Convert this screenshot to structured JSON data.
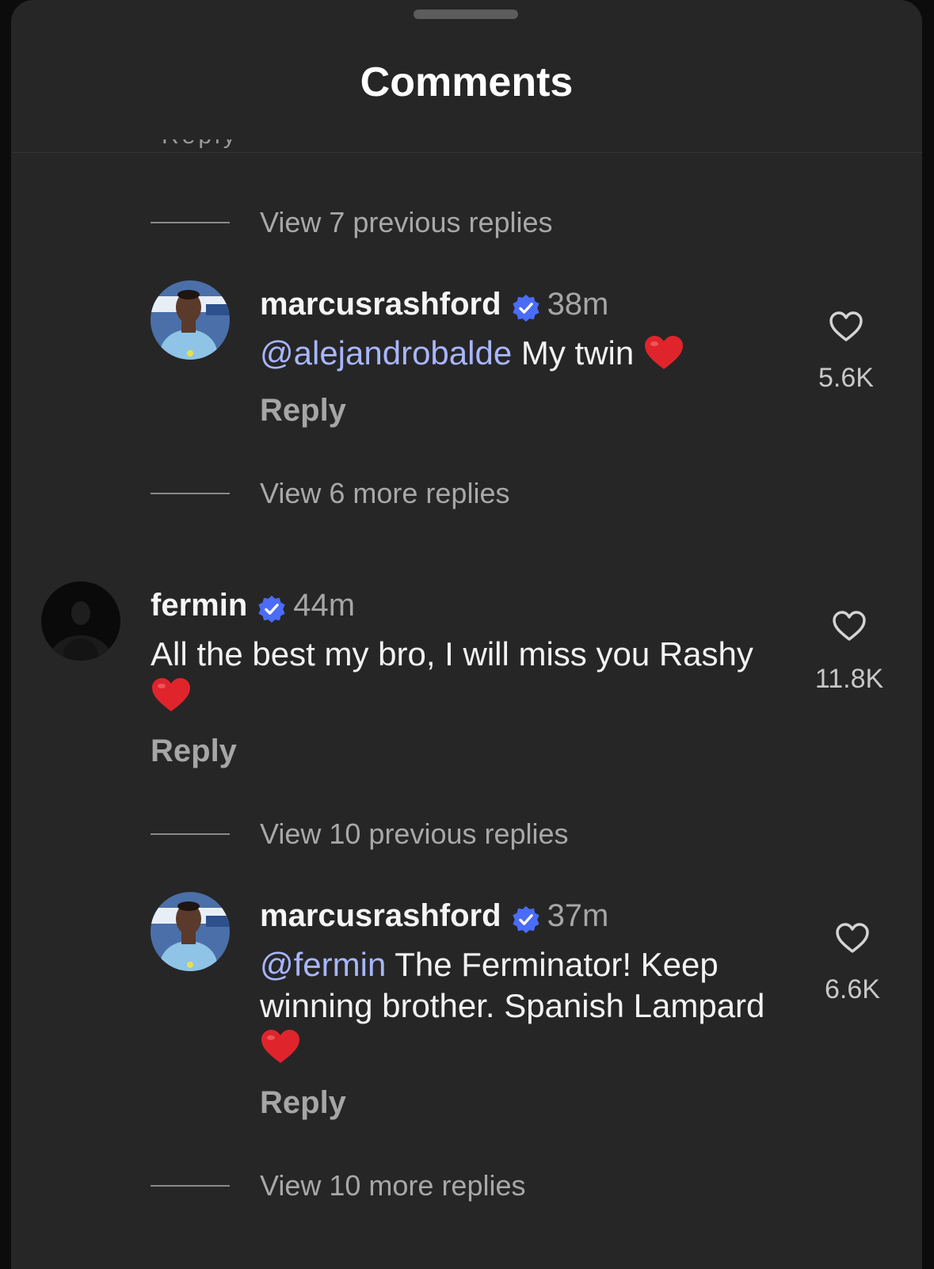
{
  "header": {
    "title": "Comments",
    "cutoff_text": "Reply"
  },
  "threads": {
    "view_previous_1": "View 7 previous replies",
    "view_more_1": "View 6 more replies",
    "view_previous_2": "View 10 previous replies",
    "view_more_2": "View 10 more replies"
  },
  "comments": [
    {
      "username": "marcusrashford",
      "time": "38m",
      "mention": "@alejandrobalde",
      "text": " My twin ",
      "reply_label": "Reply",
      "likes": "5.6K",
      "verified": true
    },
    {
      "username": "fermin",
      "time": "44m",
      "mention": "",
      "text": "All the best my bro, I will miss you Rashy",
      "reply_label": "Reply",
      "likes": "11.8K",
      "verified": true
    },
    {
      "username": "marcusrashford",
      "time": "37m",
      "mention": "@fermin",
      "text_line1": " The Ferminator! Keep",
      "text_line2": "winning brother. Spanish Lampard",
      "reply_label": "Reply",
      "likes": "6.6K",
      "verified": true
    }
  ],
  "colors": {
    "background": "#262626",
    "mention": "#a8b6ff",
    "verified_badge": "#4a6cf7",
    "heart_emoji": "#e0242c"
  },
  "icons": [
    "verified-badge-icon",
    "heart-outline-icon",
    "red-heart-emoji"
  ]
}
